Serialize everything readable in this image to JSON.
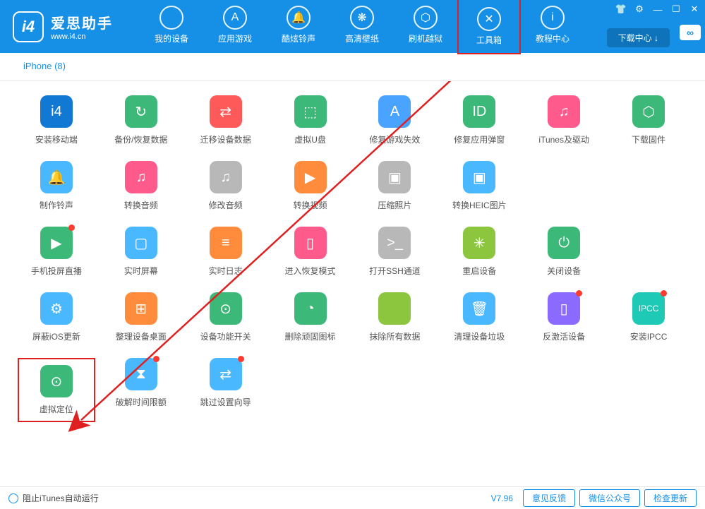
{
  "logo": {
    "title": "爱思助手",
    "subtitle": "www.i4.cn",
    "badge": "i4"
  },
  "nav": [
    {
      "label": "我的设备",
      "icon": ""
    },
    {
      "label": "应用游戏",
      "icon": "A"
    },
    {
      "label": "酷炫铃声",
      "icon": "🔔"
    },
    {
      "label": "高清壁纸",
      "icon": "❋"
    },
    {
      "label": "刷机越狱",
      "icon": "⬡"
    },
    {
      "label": "工具箱",
      "icon": "✕",
      "highlighted": true
    },
    {
      "label": "教程中心",
      "icon": "i"
    }
  ],
  "download_center": "下载中心 ↓",
  "side_icon": "∞",
  "tab": "iPhone (8)",
  "tools": [
    {
      "label": "安装移动端",
      "color": "#1178d4",
      "icon": "i4"
    },
    {
      "label": "备份/恢复数据",
      "color": "#3cb878",
      "icon": "↻"
    },
    {
      "label": "迁移设备数据",
      "color": "#ff5a5a",
      "icon": "⇄"
    },
    {
      "label": "虚拟U盘",
      "color": "#3cb878",
      "icon": "⬚"
    },
    {
      "label": "修复游戏失效",
      "color": "#4aa3ff",
      "icon": "A"
    },
    {
      "label": "修复应用弹窗",
      "color": "#3cb878",
      "icon": "ID"
    },
    {
      "label": "iTunes及驱动",
      "color": "#ff5a8c",
      "icon": "♫"
    },
    {
      "label": "下载固件",
      "color": "#3cb878",
      "icon": "⬡"
    },
    {
      "label": "制作铃声",
      "color": "#4ab8ff",
      "icon": "🔔"
    },
    {
      "label": "转换音频",
      "color": "#ff5a8c",
      "icon": "♫"
    },
    {
      "label": "修改音频",
      "color": "#b8b8b8",
      "icon": "♫"
    },
    {
      "label": "转换视频",
      "color": "#ff8c3c",
      "icon": "▶"
    },
    {
      "label": "压缩照片",
      "color": "#b8b8b8",
      "icon": "▣"
    },
    {
      "label": "转换HEIC图片",
      "color": "#4ab8ff",
      "icon": "▣"
    },
    {
      "label": "",
      "empty": true
    },
    {
      "label": "",
      "empty": true
    },
    {
      "label": "手机投屏直播",
      "color": "#3cb878",
      "icon": "▶",
      "dot": true
    },
    {
      "label": "实时屏幕",
      "color": "#4ab8ff",
      "icon": "▢"
    },
    {
      "label": "实时日志",
      "color": "#ff8c3c",
      "icon": "≡"
    },
    {
      "label": "进入恢复模式",
      "color": "#ff5a8c",
      "icon": "▯"
    },
    {
      "label": "打开SSH通道",
      "color": "#b8b8b8",
      "icon": ">_"
    },
    {
      "label": "重启设备",
      "color": "#8cc63f",
      "icon": "✳"
    },
    {
      "label": "关闭设备",
      "color": "#3cb878",
      "icon": "⏻"
    },
    {
      "label": "",
      "empty": true
    },
    {
      "label": "屏蔽iOS更新",
      "color": "#4ab8ff",
      "icon": "⚙"
    },
    {
      "label": "整理设备桌面",
      "color": "#ff8c3c",
      "icon": "⊞"
    },
    {
      "label": "设备功能开关",
      "color": "#3cb878",
      "icon": "⊙"
    },
    {
      "label": "删除顽固图标",
      "color": "#3cb878",
      "icon": "◔"
    },
    {
      "label": "抹除所有数据",
      "color": "#8cc63f",
      "icon": ""
    },
    {
      "label": "清理设备垃圾",
      "color": "#4ab8ff",
      "icon": "🗑"
    },
    {
      "label": "反激活设备",
      "color": "#8a6aff",
      "icon": "▯",
      "dot": true
    },
    {
      "label": "安装IPCC",
      "color": "#1ec9b6",
      "icon": "IPCC",
      "dot": true
    },
    {
      "label": "虚拟定位",
      "color": "#3cb878",
      "icon": "⊙",
      "highlighted": true
    },
    {
      "label": "破解时间限额",
      "color": "#4ab8ff",
      "icon": "⧗",
      "dot": true
    },
    {
      "label": "跳过设置向导",
      "color": "#4ab8ff",
      "icon": "⇄",
      "dot": true
    }
  ],
  "status": {
    "itunes": "阻止iTunes自动运行",
    "version": "V7.96",
    "feedback": "意见反馈",
    "wechat": "微信公众号",
    "update": "检查更新"
  },
  "chart_data": null
}
